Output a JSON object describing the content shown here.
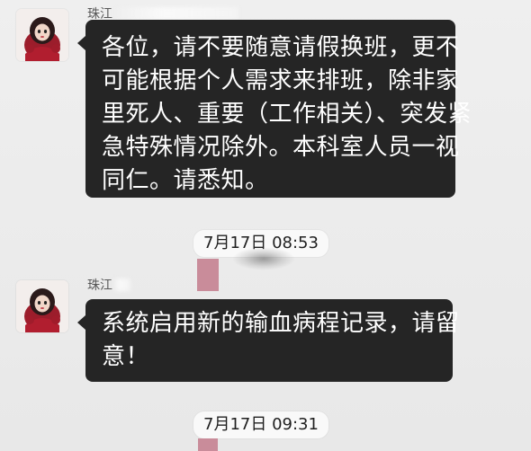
{
  "messages": [
    {
      "sender": "珠江",
      "lines": [
        "各位，请不要随意请假换班，更不",
        "可能根据个人需求来排班，除非家",
        "里死人、重要（工作相关）、突发紧",
        "急特殊情况除外。本科室人员一视",
        "同仁。请悉知。"
      ]
    },
    {
      "sender": "珠江",
      "lines": [
        "系统启用新的输血病程记录，请留",
        "意！"
      ]
    }
  ],
  "timestamps": [
    "7月17日 08:53",
    "7月17日 09:31"
  ],
  "colors": {
    "bubble": "#252525",
    "timestamp_bg": "#f9f9f9",
    "background": "#ececec"
  },
  "icons": [
    "avatar-image"
  ]
}
